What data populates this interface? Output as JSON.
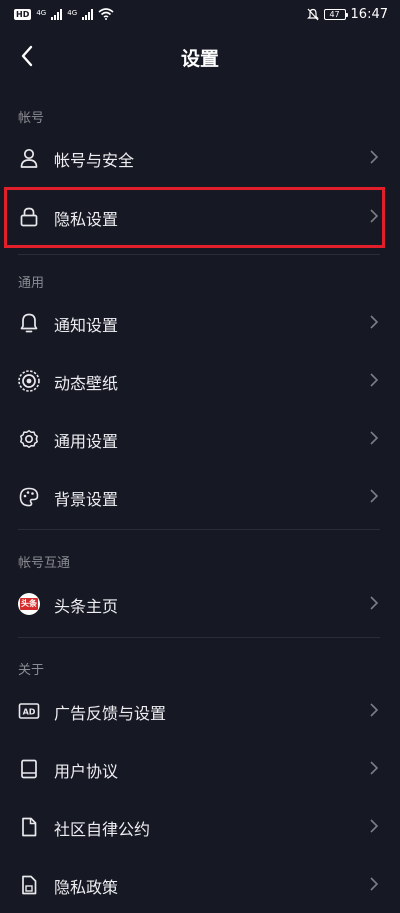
{
  "status_bar": {
    "hd_label": "HD",
    "network_1": "4G",
    "network_2": "4G",
    "battery": "47",
    "time": "16:47"
  },
  "header": {
    "title": "设置"
  },
  "sections": {
    "account": {
      "label": "帐号",
      "items": [
        {
          "label": "帐号与安全",
          "icon": "person-icon"
        },
        {
          "label": "隐私设置",
          "icon": "lock-icon",
          "highlighted": true
        }
      ]
    },
    "general": {
      "label": "通用",
      "items": [
        {
          "label": "通知设置",
          "icon": "bell-icon"
        },
        {
          "label": "动态壁纸",
          "icon": "wallpaper-icon"
        },
        {
          "label": "通用设置",
          "icon": "gear-icon"
        },
        {
          "label": "背景设置",
          "icon": "palette-icon"
        }
      ]
    },
    "linked": {
      "label": "帐号互通",
      "items": [
        {
          "label": "头条主页",
          "icon": "toutiao-logo-icon",
          "badge": "头条"
        }
      ]
    },
    "about": {
      "label": "关于",
      "items": [
        {
          "label": "广告反馈与设置",
          "icon": "ad-icon",
          "icon_text": "AD"
        },
        {
          "label": "用户协议",
          "icon": "book-icon"
        },
        {
          "label": "社区自律公约",
          "icon": "document-icon"
        },
        {
          "label": "隐私政策",
          "icon": "lock-document-icon"
        }
      ]
    }
  },
  "colors": {
    "background": "#161823",
    "highlight_border": "#e01f2a",
    "section_label": "#8a8b93"
  }
}
